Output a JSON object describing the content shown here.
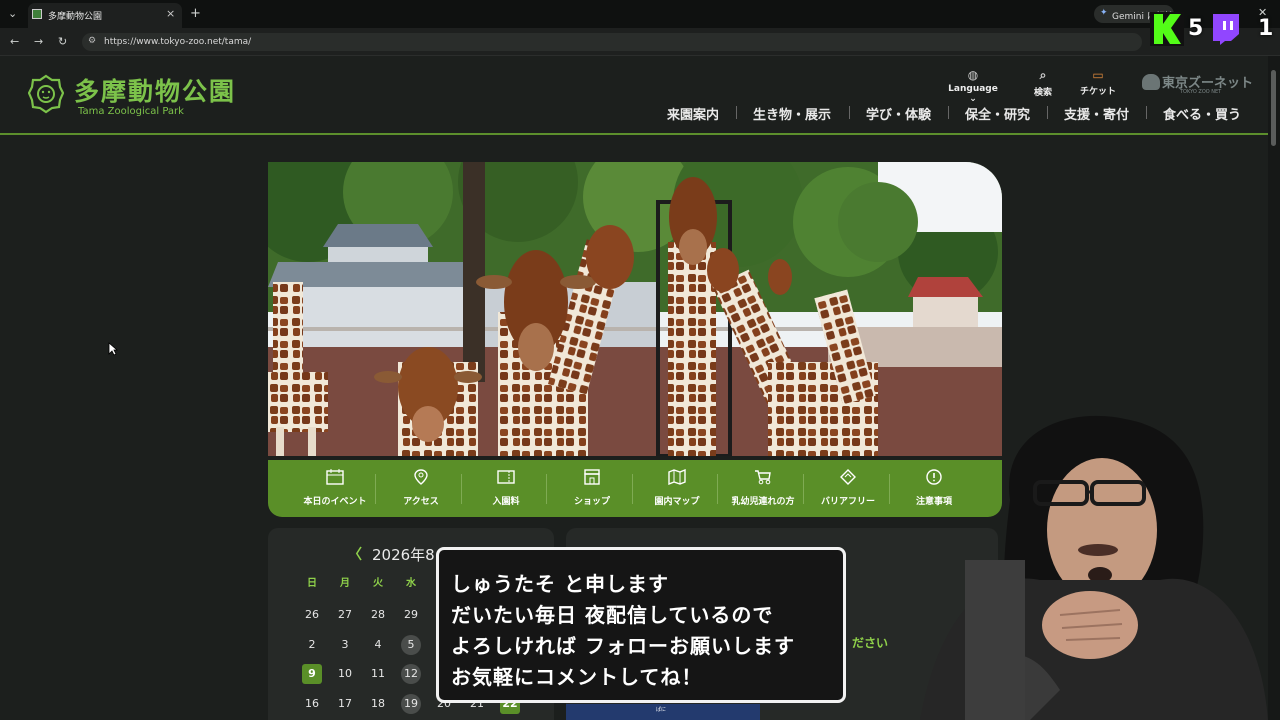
{
  "browser": {
    "tab_title": "多摩動物公園",
    "new_tab": "+",
    "url": "https://www.tokyo-zoo.net/tama/",
    "gemini_label": "Gemini に相談"
  },
  "stream_overlay": {
    "k_count": "5",
    "twitch_count": "1"
  },
  "site": {
    "logo_jp": "多摩動物公園",
    "logo_en": "Tama Zoological Park",
    "utility": {
      "language": "Language",
      "search": "検索",
      "ticket": "チケット",
      "brand": "東京ズーネット",
      "brand_sub": "TOKYO ZOO NET"
    },
    "nav": [
      "来園案内",
      "生き物・展示",
      "学び・体験",
      "保全・研究",
      "支援・寄付",
      "食べる・買う"
    ],
    "quick_nav": [
      "本日のイベント",
      "アクセス",
      "入園料",
      "ショップ",
      "園内マップ",
      "乳幼児連れの方",
      "バリアフリー",
      "注意事項"
    ]
  },
  "calendar": {
    "prev": "〈",
    "month": "2026年8",
    "weekdays": [
      "日",
      "月",
      "火",
      "水"
    ],
    "rows": [
      [
        "26",
        "27",
        "28",
        "29"
      ],
      [
        "2",
        "3",
        "4",
        "5"
      ],
      [
        "9",
        "10",
        "11",
        "12"
      ],
      [
        "16",
        "17",
        "18",
        "19",
        "20",
        "21",
        "22"
      ]
    ]
  },
  "right_card": {
    "partial_text": "ださい",
    "partial_thumb": "ぱに"
  },
  "subtitle_box": {
    "lines": [
      "しゅうたそ と申します",
      "だいたい毎日 夜配信しているので",
      "よろしければ フォローお願いします",
      "お気軽にコメントしてね！"
    ]
  },
  "colors": {
    "accent_green": "#5a8f28",
    "page_bg": "#1c1f1d",
    "logo_green": "#7cc24a"
  }
}
